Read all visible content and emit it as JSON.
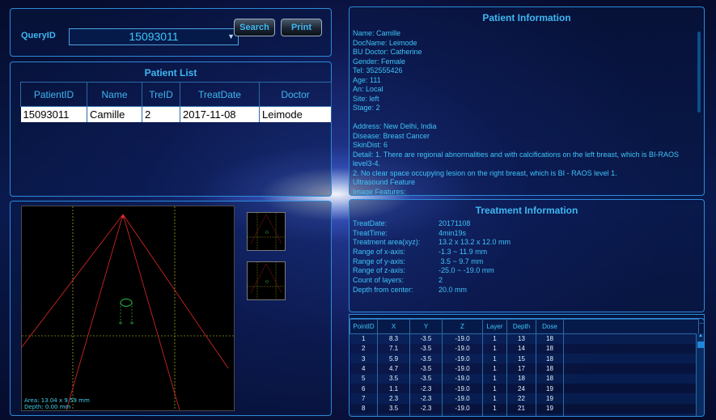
{
  "query": {
    "label": "QueryID",
    "value": "15093011",
    "search_label": "Search",
    "print_label": "Print"
  },
  "patient_list": {
    "title": "Patient List",
    "columns": [
      "PatientID",
      "Name",
      "TreID",
      "TreatDate",
      "Doctor"
    ],
    "rows": [
      [
        "15093011",
        "Camille",
        "2",
        "2017-11-08",
        "Leimode"
      ]
    ]
  },
  "image": {
    "area_text": "Area: 13.04 x 9.59 mm",
    "depth_text": "Depth: 0.00 mm"
  },
  "patient_info": {
    "title": "Patient Information",
    "lines": [
      "Name:  Camille",
      "DocName:  Leimode",
      "BU Doctor:  Catherine",
      "Gender:  Female",
      "Tel:   352555426",
      "Age:   111",
      "An:   Local",
      "Site:  left",
      "Stage:   2",
      "",
      "Address:   New Delhi, India",
      "Disease:   Breast Cancer",
      "SkinDist:  6",
      "Detail:   1. There are regional abnormalities and with calcifications on the left breast, which is BI-RAOS level3-4.",
      "2. No clear space occupying lesion on the right breast, which is BI - RAOS level 1.",
      "Ultrasound Feature",
      "Image Features:"
    ]
  },
  "treatment_info": {
    "title": "Treatment Information",
    "rows": [
      {
        "k": "TreatDate:",
        "v": "20171108"
      },
      {
        "k": "TreatTime:",
        "v": "4min19s"
      },
      {
        "k": "Treatment area(xyz):",
        "v": "13.2 x 13.2 x 12.0 mm"
      },
      {
        "k": "Range of x-axis:",
        "v": "-1.3 ~ 11.9  mm"
      },
      {
        "k": "Range of y-axis:",
        "v": " 3.5 ~ 9.7 mm"
      },
      {
        "k": "Range of z-axis:",
        "v": "-25.0 ~ -19.0 mm"
      },
      {
        "k": "Count of layers:",
        "v": "2"
      },
      {
        "k": "Depth from center:",
        "v": "20.0 mm"
      }
    ],
    "collapse_glyph": "︽"
  },
  "points": {
    "columns": [
      "PointID",
      "X",
      "Y",
      "Z",
      "Layer",
      "Depth",
      "Dose"
    ],
    "rows": [
      [
        "1",
        "8.3",
        "-3.5",
        "-19.0",
        "1",
        "13",
        "18"
      ],
      [
        "2",
        "7.1",
        "-3.5",
        "-19.0",
        "1",
        "14",
        "18"
      ],
      [
        "3",
        "5.9",
        "-3.5",
        "-19.0",
        "1",
        "15",
        "18"
      ],
      [
        "4",
        "4.7",
        "-3.5",
        "-19.0",
        "1",
        "17",
        "18"
      ],
      [
        "5",
        "3.5",
        "-3.5",
        "-19.0",
        "1",
        "18",
        "18"
      ],
      [
        "6",
        "1.1",
        "-2.3",
        "-19.0",
        "1",
        "24",
        "19"
      ],
      [
        "7",
        "2.3",
        "-2.3",
        "-19.0",
        "1",
        "22",
        "19"
      ],
      [
        "8",
        "3.5",
        "-2.3",
        "-19.0",
        "1",
        "21",
        "19"
      ],
      [
        "9",
        "4.7",
        "-2.3",
        "-19.0",
        "1",
        "20",
        "19"
      ]
    ]
  }
}
